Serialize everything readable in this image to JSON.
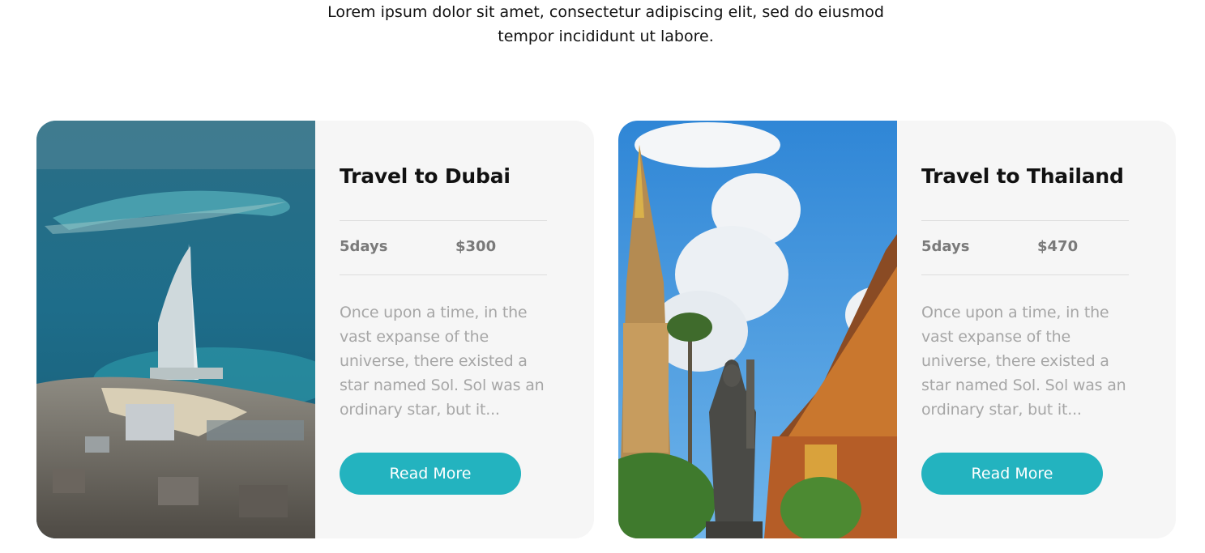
{
  "intro": {
    "line1": "Lorem ipsum dolor sit amet, consectetur adipiscing elit, sed do eiusmod",
    "line2": "tempor incididunt ut labore."
  },
  "cards": [
    {
      "title": "Travel to Dubai",
      "duration": "5days",
      "price": "$300",
      "excerpt": "Once upon a time, in the vast expanse of the universe, there existed a star named Sol. Sol was an ordinary star, but it...",
      "button_label": "Read More",
      "image_subject": "dubai-aerial-photo"
    },
    {
      "title": "Travel to Thailand",
      "duration": "5days",
      "price": "$470",
      "excerpt": "Once upon a time, in the vast expanse of the universe, there existed a star named Sol. Sol was an ordinary star, but it...",
      "button_label": "Read More",
      "image_subject": "thailand-temple-photo"
    }
  ],
  "colors": {
    "accent": "#23b3bf",
    "card_bg": "#f6f6f6",
    "title": "#111111",
    "meta": "#7a7a7a",
    "excerpt": "#a6a6a6"
  }
}
